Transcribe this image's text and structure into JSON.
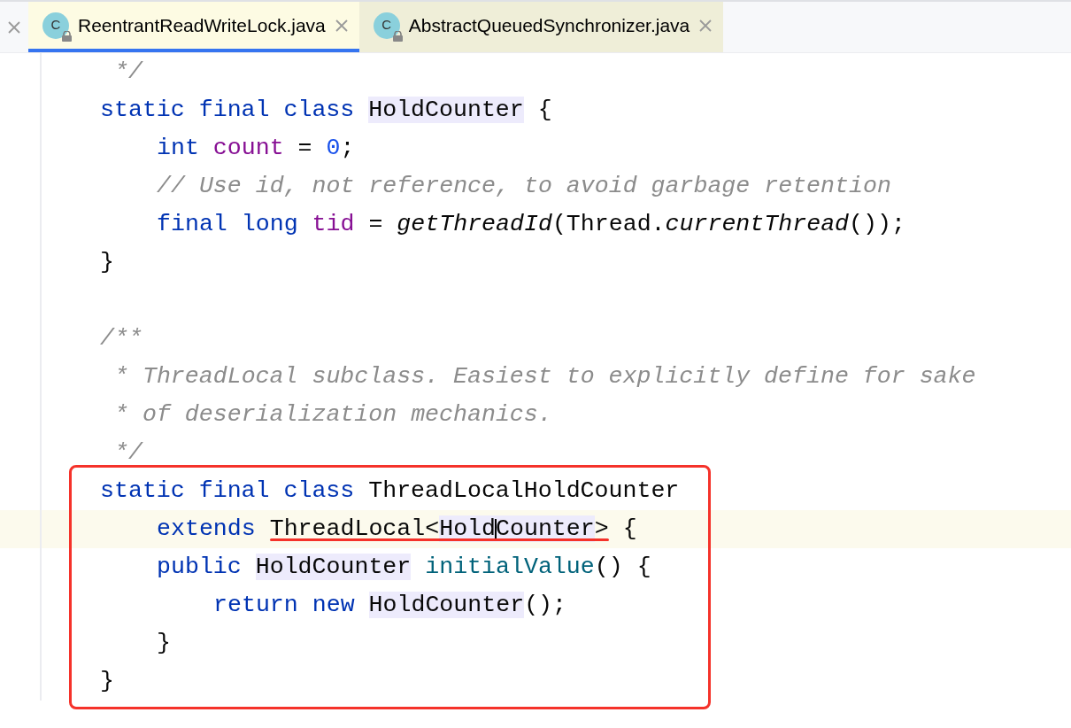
{
  "clipped_tab": {
    "closable": true
  },
  "tabs": [
    {
      "icon_letter": "C",
      "label": "ReentrantReadWriteLock.java",
      "selected": true
    },
    {
      "icon_letter": "C",
      "label": "AbstractQueuedSynchronizer.java",
      "selected": false
    }
  ],
  "code": [
    {
      "boxed": false,
      "lines": [
        {
          "kind": "code",
          "tokens": [
            {
              "kind": "doc_inner",
              "text": "*/"
            }
          ]
        },
        {
          "kind": "code",
          "tokens": [
            {
              "kind": "kw",
              "text": "static final class "
            },
            {
              "kind": "ref",
              "text": "HoldCounter"
            },
            {
              "kind": "plain",
              "text": " {"
            }
          ],
          "children": [
            {
              "kind": "code",
              "tokens": [
                {
                  "kind": "kw",
                  "text": "int "
                },
                {
                  "kind": "field",
                  "text": "count"
                },
                {
                  "kind": "plain",
                  "text": " = "
                },
                {
                  "kind": "num",
                  "text": "0"
                },
                {
                  "kind": "plain",
                  "text": ";"
                }
              ]
            },
            {
              "kind": "code",
              "tokens": [
                {
                  "kind": "comment",
                  "text": "// Use id, not reference, to avoid garbage retention"
                }
              ]
            },
            {
              "kind": "code",
              "tokens": [
                {
                  "kind": "kw",
                  "text": "final long "
                },
                {
                  "kind": "field",
                  "text": "tid"
                },
                {
                  "kind": "plain",
                  "text": " = "
                },
                {
                  "kind": "static",
                  "text": "getThreadId"
                },
                {
                  "kind": "plain",
                  "text": "(Thread."
                },
                {
                  "kind": "static",
                  "text": "currentThread"
                },
                {
                  "kind": "plain",
                  "text": "());"
                }
              ]
            }
          ]
        },
        {
          "kind": "code",
          "tokens": [
            {
              "kind": "plain",
              "text": "}"
            }
          ]
        },
        {
          "kind": "blank"
        },
        {
          "kind": "code",
          "tokens": [
            {
              "kind": "doc",
              "text": "/**"
            }
          ]
        },
        {
          "kind": "code",
          "tokens": [
            {
              "kind": "doc_inner",
              "text": "* ThreadLocal subclass. Easiest to explicitly define for sake"
            }
          ]
        },
        {
          "kind": "code",
          "tokens": [
            {
              "kind": "doc_inner",
              "text": "* of deserialization mechanics."
            }
          ]
        },
        {
          "kind": "code",
          "tokens": [
            {
              "kind": "doc_inner",
              "text": "*/"
            }
          ]
        }
      ]
    },
    {
      "boxed": true,
      "lines": [
        {
          "kind": "code",
          "tokens": [
            {
              "kind": "kw",
              "text": "static final class "
            },
            {
              "kind": "plain",
              "text": "ThreadLocalHoldCounter"
            }
          ],
          "children": [
            {
              "kind": "code",
              "current": true,
              "tokens": [
                {
                  "kind": "kw",
                  "text": "extends "
                },
                {
                  "kind": "plain",
                  "text": "ThreadLocal<",
                  "underline": true
                },
                {
                  "kind": "ref",
                  "text": "Hold",
                  "underline": true
                },
                {
                  "kind": "ref",
                  "text": "Counter",
                  "underline": true,
                  "caret": true
                },
                {
                  "kind": "plain",
                  "text": ">",
                  "underline": true
                },
                {
                  "kind": "plain",
                  "text": " {"
                }
              ]
            },
            {
              "kind": "code",
              "tokens": [
                {
                  "kind": "kw",
                  "text": "public "
                },
                {
                  "kind": "ref",
                  "text": "HoldCounter"
                },
                {
                  "kind": "method",
                  "text": " initialValue"
                },
                {
                  "kind": "plain",
                  "text": "() {"
                }
              ],
              "children": [
                {
                  "kind": "code",
                  "tokens": [
                    {
                      "kind": "kw",
                      "text": "return new "
                    },
                    {
                      "kind": "ref",
                      "text": "HoldCounter"
                    },
                    {
                      "kind": "plain",
                      "text": "();"
                    }
                  ]
                }
              ]
            },
            {
              "kind": "code",
              "tokens": [
                {
                  "kind": "plain",
                  "text": "}"
                }
              ]
            }
          ]
        },
        {
          "kind": "code",
          "tokens": [
            {
              "kind": "plain",
              "text": "}"
            }
          ]
        }
      ]
    }
  ]
}
